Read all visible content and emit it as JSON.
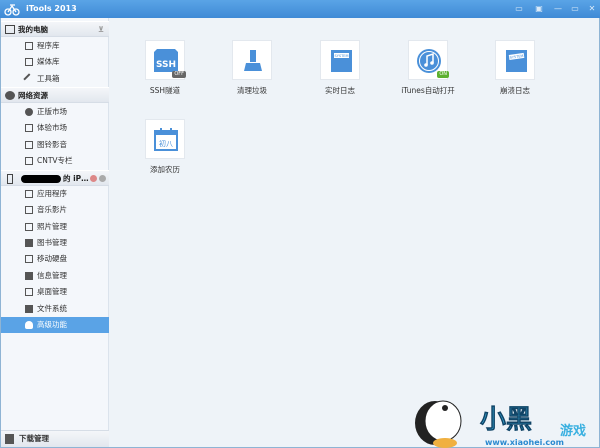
{
  "window": {
    "title": "iTools 2013",
    "controls": [
      "feedback",
      "skin",
      "minimize",
      "maximize",
      "close"
    ]
  },
  "sidebar": {
    "sections": [
      {
        "label": "我的电脑",
        "icon": "monitor-icon",
        "items": [
          {
            "label": "程序库",
            "icon": "grid-icon"
          },
          {
            "label": "媒体库",
            "icon": "film-icon"
          },
          {
            "label": "工具箱",
            "icon": "wrench-icon"
          }
        ]
      },
      {
        "label": "网络资源",
        "icon": "cloud-icon",
        "items": [
          {
            "label": "正版市场",
            "icon": "apple-icon"
          },
          {
            "label": "体验市场",
            "icon": "grid-icon"
          },
          {
            "label": "图铃影音",
            "icon": "media-icon"
          },
          {
            "label": "CNTV专栏",
            "icon": "tv-icon"
          }
        ]
      },
      {
        "label": "的 iP…",
        "icon": "phone-icon",
        "items": [
          {
            "label": "应用程序",
            "icon": "grid-icon"
          },
          {
            "label": "音乐影片",
            "icon": "film-icon"
          },
          {
            "label": "照片管理",
            "icon": "photo-icon"
          },
          {
            "label": "图书管理",
            "icon": "book-icon"
          },
          {
            "label": "移动硬盘",
            "icon": "disk-icon"
          },
          {
            "label": "信息管理",
            "icon": "contact-icon"
          },
          {
            "label": "桌面管理",
            "icon": "desktop-icon"
          },
          {
            "label": "文件系统",
            "icon": "folder-icon"
          },
          {
            "label": "高级功能",
            "icon": "flask-icon",
            "selected": true
          }
        ]
      }
    ],
    "download": "下载管理"
  },
  "main": {
    "tools": [
      {
        "label": "SSH隧道",
        "icon": "ssh-icon",
        "badge": "OFF",
        "glyph": "SSH"
      },
      {
        "label": "清理垃圾",
        "icon": "broom-icon"
      },
      {
        "label": "实时日志",
        "icon": "system-log-icon",
        "glyph": "SYSTEM"
      },
      {
        "label": "iTunes自动打开",
        "icon": "itunes-icon",
        "badge": "ON"
      },
      {
        "label": "崩溃日志",
        "icon": "crash-log-icon",
        "glyph": "SYSTEM"
      },
      {
        "label": "添加农历",
        "icon": "calendar-icon",
        "glyph": "初八"
      }
    ]
  },
  "watermark": {
    "text": "小黑游戏",
    "url": "www.xiaohei.com"
  },
  "colors": {
    "accent": "#5aa3e6",
    "titlebar": "#3f8ad6",
    "on": "#5cb030",
    "off": "#666"
  }
}
